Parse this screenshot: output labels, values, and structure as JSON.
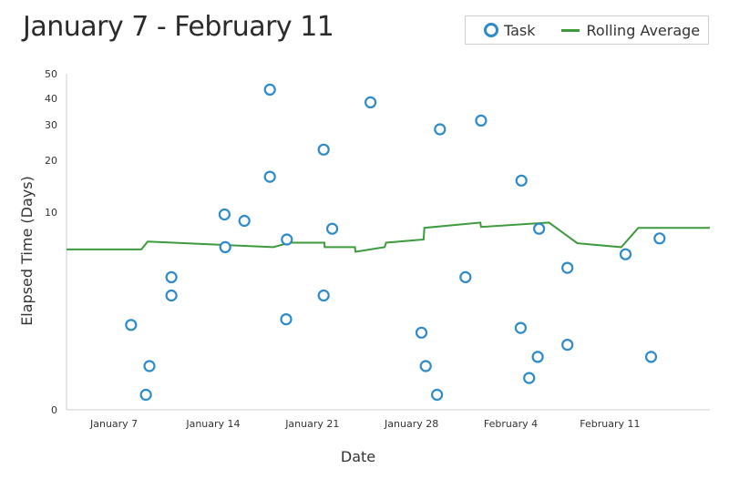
{
  "chart_data": {
    "type": "scatter",
    "title": "January 7 - February 11",
    "xlabel": "Date",
    "ylabel": "Elapsed Time (Days)",
    "y_scale": "log1p",
    "ylim": [
      0,
      50
    ],
    "y_ticks": [
      0,
      10,
      20,
      30,
      40,
      50
    ],
    "x_unit": "days since January 7",
    "xlim": [
      -3.35,
      42.05
    ],
    "x_ticks": [
      {
        "day": 0,
        "label": "January 7"
      },
      {
        "day": 7,
        "label": "January 14"
      },
      {
        "day": 14,
        "label": "January 21"
      },
      {
        "day": 21,
        "label": "January 28"
      },
      {
        "day": 28,
        "label": "February 4"
      },
      {
        "day": 35,
        "label": "February 11"
      }
    ],
    "grid": false,
    "legend": {
      "placement": "top-right",
      "entries": [
        {
          "label": "Task",
          "marker": "circle",
          "color": "#2e8bc9"
        },
        {
          "label": "Rolling Average",
          "marker": "line",
          "color": "#3d9a3d"
        }
      ]
    },
    "series": [
      {
        "name": "Task",
        "kind": "scatter",
        "color": "#2e8bc9",
        "points": [
          {
            "x": 1.2,
            "y": 1.8
          },
          {
            "x": 2.5,
            "y": 0.7
          },
          {
            "x": 2.25,
            "y": 0.2
          },
          {
            "x": 4.05,
            "y": 4.0
          },
          {
            "x": 4.05,
            "y": 3.0
          },
          {
            "x": 7.85,
            "y": 6.2
          },
          {
            "x": 7.8,
            "y": 9.7
          },
          {
            "x": 9.2,
            "y": 8.9
          },
          {
            "x": 11.0,
            "y": 43.3
          },
          {
            "x": 11.0,
            "y": 16.1
          },
          {
            "x": 12.2,
            "y": 6.9
          },
          {
            "x": 12.15,
            "y": 2.0
          },
          {
            "x": 14.8,
            "y": 22.6
          },
          {
            "x": 14.8,
            "y": 3.0
          },
          {
            "x": 15.4,
            "y": 8.0
          },
          {
            "x": 18.1,
            "y": 38.3
          },
          {
            "x": 21.7,
            "y": 1.55
          },
          {
            "x": 22.0,
            "y": 0.7
          },
          {
            "x": 22.8,
            "y": 0.2
          },
          {
            "x": 23.0,
            "y": 28.5
          },
          {
            "x": 24.8,
            "y": 4.0
          },
          {
            "x": 25.9,
            "y": 31.4
          },
          {
            "x": 28.7,
            "y": 1.7
          },
          {
            "x": 28.75,
            "y": 15.3
          },
          {
            "x": 29.3,
            "y": 0.47
          },
          {
            "x": 29.9,
            "y": 0.9
          },
          {
            "x": 30.0,
            "y": 8.0
          },
          {
            "x": 32.0,
            "y": 4.6
          },
          {
            "x": 32.0,
            "y": 1.2
          },
          {
            "x": 36.1,
            "y": 5.6
          },
          {
            "x": 37.9,
            "y": 0.9
          },
          {
            "x": 38.5,
            "y": 7.0
          }
        ]
      },
      {
        "name": "Rolling Average",
        "kind": "line",
        "color": "#3d9a3d",
        "points": [
          {
            "x": -3.35,
            "y": 6.0
          },
          {
            "x": 1.93,
            "y": 6.0
          },
          {
            "x": 2.38,
            "y": 6.7
          },
          {
            "x": 11.25,
            "y": 6.2
          },
          {
            "x": 12.4,
            "y": 6.6
          },
          {
            "x": 14.85,
            "y": 6.6
          },
          {
            "x": 14.87,
            "y": 6.2
          },
          {
            "x": 17.0,
            "y": 6.2
          },
          {
            "x": 17.05,
            "y": 5.8
          },
          {
            "x": 19.1,
            "y": 6.2
          },
          {
            "x": 19.2,
            "y": 6.6
          },
          {
            "x": 21.85,
            "y": 6.9
          },
          {
            "x": 21.9,
            "y": 8.1
          },
          {
            "x": 25.85,
            "y": 8.7
          },
          {
            "x": 25.9,
            "y": 8.2
          },
          {
            "x": 30.7,
            "y": 8.7
          },
          {
            "x": 32.7,
            "y": 6.55
          },
          {
            "x": 35.8,
            "y": 6.2
          },
          {
            "x": 37.0,
            "y": 8.1
          },
          {
            "x": 42.05,
            "y": 8.1
          }
        ]
      }
    ]
  }
}
